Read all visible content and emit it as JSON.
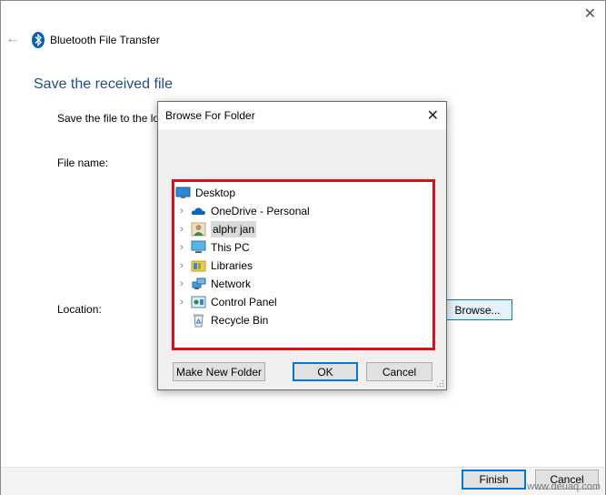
{
  "wizard": {
    "title": "Bluetooth File Transfer",
    "heading": "Save the received file",
    "instruction": "Save the file to the lo",
    "file_name_label": "File name:",
    "location_label": "Location:",
    "browse_label": "Browse...",
    "finish_label": "Finish",
    "cancel_label": "Cancel"
  },
  "dialog": {
    "title": "Browse For Folder",
    "tree": [
      {
        "label": "Desktop",
        "icon": "desktop-icon",
        "expandable": false,
        "selected": false
      },
      {
        "label": "OneDrive - Personal",
        "icon": "cloud-icon",
        "expandable": true,
        "selected": false
      },
      {
        "label": "alphr jan",
        "icon": "user-folder-icon",
        "expandable": true,
        "selected": true
      },
      {
        "label": "This PC",
        "icon": "computer-icon",
        "expandable": true,
        "selected": false
      },
      {
        "label": "Libraries",
        "icon": "libraries-icon",
        "expandable": true,
        "selected": false
      },
      {
        "label": "Network",
        "icon": "network-icon",
        "expandable": true,
        "selected": false
      },
      {
        "label": "Control Panel",
        "icon": "control-panel-icon",
        "expandable": true,
        "selected": false
      },
      {
        "label": "Recycle Bin",
        "icon": "recycle-bin-icon",
        "expandable": false,
        "selected": false
      }
    ],
    "make_new_folder_label": "Make New Folder",
    "ok_label": "OK",
    "cancel_label": "Cancel"
  },
  "colors": {
    "accent": "#0078d7",
    "highlight_border": "#d6111c",
    "heading": "#1f4e8c"
  },
  "watermark": "www.deuaq.com"
}
